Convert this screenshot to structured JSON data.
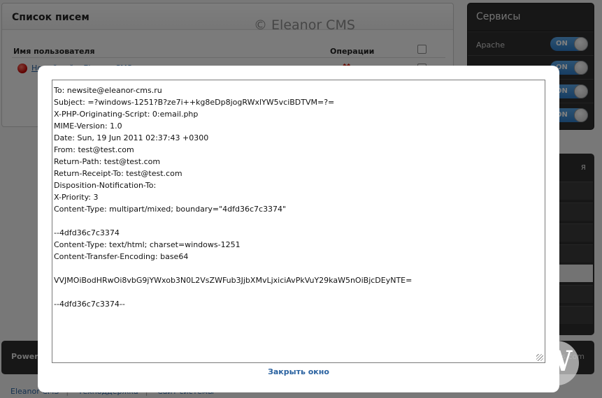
{
  "background": {
    "panel_title": "Список писем",
    "watermark": "© Eleanor CMS",
    "columns": {
      "user": "Имя пользователя",
      "operations": "Операции"
    },
    "row_link": "Новый сайт: Eleanor CMS",
    "services_title": "Сервисы",
    "services": [
      {
        "label": "Apache",
        "state": "ON"
      },
      {
        "label": "",
        "state": "ON"
      },
      {
        "label": "",
        "state": "ON"
      },
      {
        "label": "",
        "state": "ON"
      }
    ],
    "side2_title": "я",
    "footer_left": "Powere",
    "footer_right": "rts.com",
    "footer_links": [
      "Eleanor CMS",
      "Техподдержка",
      "Сайт системы"
    ]
  },
  "modal": {
    "lines": [
      "To: newsite@eleanor-cms.ru",
      "Subject: =?windows-1251?B?ze7i++kg8eDp8jogRWxlYW5vciBDTVM=?=",
      "X-PHP-Originating-Script: 0:email.php",
      "MIME-Version: 1.0",
      "Date: Sun, 19 Jun 2011 02:37:43 +0300",
      "From: test@test.com",
      "Return-Path: test@test.com",
      "Return-Receipt-To: test@test.com",
      "Disposition-Notification-To:",
      "X-Priority: 3",
      "Content-Type: multipart/mixed; boundary=\"4dfd36c7c3374\"",
      "",
      "--4dfd36c7c3374",
      "Content-Type: text/html; charset=windows-1251",
      "Content-Transfer-Encoding: base64",
      "",
      "VVJMOiBodHRwOi8vbG9jYWxob3N0L2VsZWFub3JjbXMvLjxiciAvPkVuY29kaW5nOiBjcDEyNTE=",
      "",
      "--4dfd36c7c3374--"
    ],
    "close_label": "Закрыть окно"
  }
}
